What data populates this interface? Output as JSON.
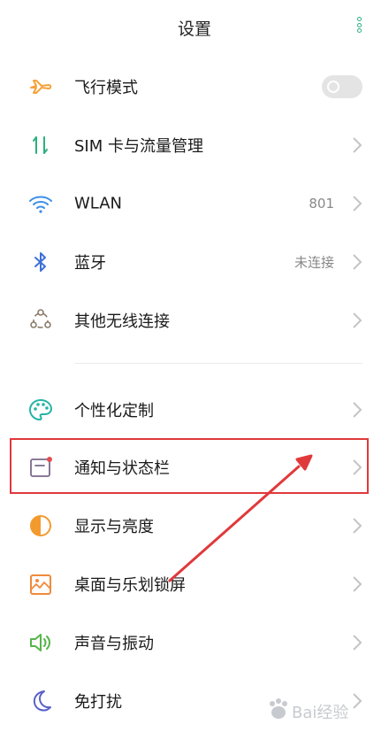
{
  "header": {
    "title": "设置"
  },
  "sections": [
    {
      "items": [
        {
          "id": "airplane",
          "label": "飞行模式",
          "icon": "airplane-icon",
          "control": "toggle",
          "toggle_on": false
        },
        {
          "id": "sim",
          "label": "SIM 卡与流量管理",
          "icon": "sim-data-icon",
          "control": "chevron"
        },
        {
          "id": "wlan",
          "label": "WLAN",
          "value": "801",
          "icon": "wifi-icon",
          "control": "chevron"
        },
        {
          "id": "bluetooth",
          "label": "蓝牙",
          "value": "未连接",
          "icon": "bluetooth-icon",
          "control": "chevron"
        },
        {
          "id": "wireless",
          "label": "其他无线连接",
          "icon": "wireless-connections-icon",
          "control": "chevron"
        }
      ]
    },
    {
      "items": [
        {
          "id": "personalize",
          "label": "个性化定制",
          "icon": "palette-icon",
          "control": "chevron"
        },
        {
          "id": "notifications",
          "label": "通知与状态栏",
          "icon": "notification-icon",
          "control": "chevron",
          "highlighted": true
        },
        {
          "id": "display",
          "label": "显示与亮度",
          "icon": "brightness-icon",
          "control": "chevron"
        },
        {
          "id": "homescreen",
          "label": "桌面与乐划锁屏",
          "icon": "wallpaper-icon",
          "control": "chevron"
        },
        {
          "id": "sound",
          "label": "声音与振动",
          "icon": "speaker-icon",
          "control": "chevron"
        },
        {
          "id": "dnd",
          "label": "免打扰",
          "icon": "moon-icon",
          "control": "chevron"
        }
      ]
    }
  ],
  "annotation": {
    "color": "#e0393b"
  },
  "watermark": {
    "text": "Bai经验"
  },
  "colors": {
    "accent": "#2bb07f",
    "highlight": "#e0393b"
  }
}
